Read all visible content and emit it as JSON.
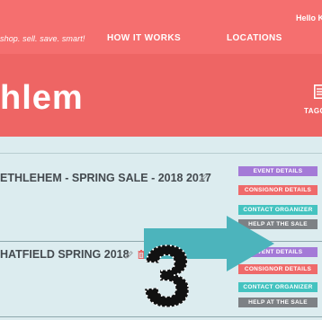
{
  "header": {
    "tagline": "shop. sell. save. smart!",
    "nav": [
      "HOW IT WORKS",
      "LOCATIONS"
    ],
    "greeting": "Hello K"
  },
  "hero": {
    "title": "hlem",
    "tag_label": "TAGG",
    "tag_icon": "tag-document-icon"
  },
  "sales": [
    {
      "title": "ETHLEHEM - SPRING SALE - 2018 2017",
      "edit_icon": "pencil-icon",
      "buttons": [
        "EVENT DETAILS",
        "CONSIGNOR DETAILS",
        "CONTACT ORGANIZER",
        "HELP AT THE SALE"
      ]
    },
    {
      "title": "HATFIELD SPRING 2018",
      "edit_icon": "pencil-icon",
      "delete_icon": "trash-icon",
      "buttons": [
        "EVENT DETAILS",
        "CONSIGNOR DETAILS",
        "CONTACT ORGANIZER",
        "HELP AT THE SALE"
      ]
    }
  ],
  "annotation": {
    "step_number": "3",
    "arrow_color": "#4cb4bc"
  },
  "colors": {
    "header": "#f56f6f",
    "hero": "#ee6564",
    "page_bg": "#dcecef",
    "event_details": "#a47ad7",
    "consignor_details": "#ef6a6a",
    "contact_organizer": "#44c3c0",
    "help_at_sale": "#7d8185"
  }
}
